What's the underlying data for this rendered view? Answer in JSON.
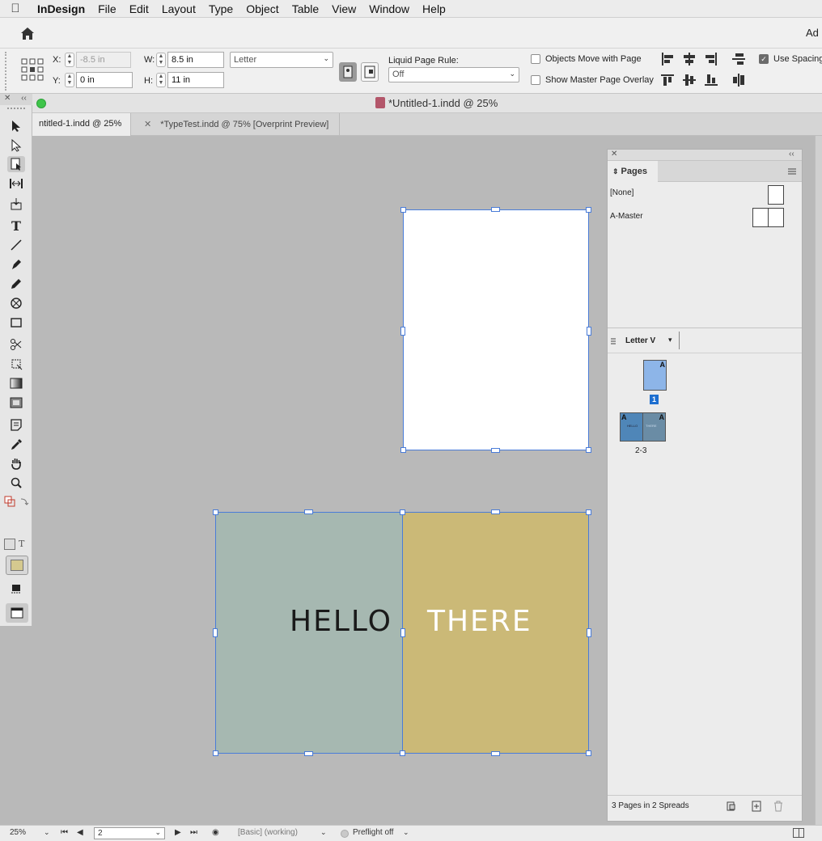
{
  "menubar": {
    "app": "InDesign",
    "items": [
      "File",
      "Edit",
      "Layout",
      "Type",
      "Object",
      "Table",
      "View",
      "Window",
      "Help"
    ]
  },
  "appbar": {
    "right_text": "Ad"
  },
  "control": {
    "x_label": "X:",
    "x_value": "-8.5 in",
    "y_label": "Y:",
    "y_value": "0 in",
    "w_label": "W:",
    "w_value": "8.5 in",
    "h_label": "H:",
    "h_value": "11 in",
    "page_size": "Letter",
    "liquid_label": "Liquid Page Rule:",
    "liquid_value": "Off",
    "objects_move": "Objects Move with Page",
    "show_master": "Show Master Page Overlay",
    "use_spacing": "Use Spacing"
  },
  "document": {
    "title": "*Untitled-1.indd @ 25%",
    "tabs": [
      "ntitled-1.indd @ 25%",
      "*TypeTest.indd @ 75% [Overprint Preview]"
    ]
  },
  "canvas": {
    "left_text": "HELLO",
    "right_text": "THERE",
    "colors": {
      "left_page": "#a6b8b1",
      "right_page": "#cbb977",
      "left_text": "#1a1a1a",
      "right_text": "#ffffff",
      "selection": "#4a7cd8"
    }
  },
  "pages_panel": {
    "tab": "Pages",
    "none_label": "[None]",
    "master_label": "A-Master",
    "size_label": "Letter V",
    "page1_number": "1",
    "page1_prefix": "A",
    "spread_label": "2-3",
    "spread_prefix_left": "A",
    "spread_prefix_right": "A",
    "spread_thumb_left": "HELLO",
    "spread_thumb_right": "THERE",
    "footer": "3 Pages in 2 Spreads"
  },
  "status": {
    "zoom": "25%",
    "page": "2",
    "profile": "[Basic] (working)",
    "preflight": "Preflight off"
  }
}
